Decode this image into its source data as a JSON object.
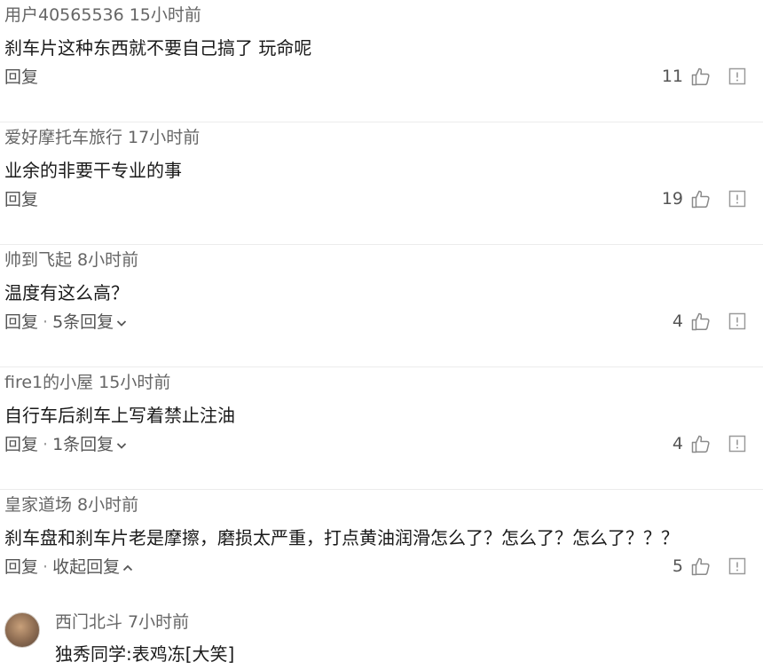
{
  "comments": [
    {
      "user": "用户40565536",
      "time": "15小时前",
      "text": "刹车片这种东西就不要自己搞了 玩命呢",
      "reply_label": "回复",
      "sub": "",
      "likes": "11"
    },
    {
      "user": "爱好摩托车旅行",
      "time": "17小时前",
      "text": "业余的非要干专业的事",
      "reply_label": "回复",
      "sub": "",
      "likes": "19"
    },
    {
      "user": "帅到飞起",
      "time": "8小时前",
      "text": "温度有这么高？",
      "reply_label": "回复",
      "sub": "5条回复",
      "likes": "4"
    },
    {
      "user": "fire1的小屋",
      "time": "15小时前",
      "text": "自行车后刹车上写着禁止注油",
      "reply_label": "回复",
      "sub": "1条回复",
      "likes": "4"
    },
    {
      "user": "皇家道场",
      "time": "8小时前",
      "text": "刹车盘和刹车片老是摩擦，磨损太严重，打点黄油润滑怎么了？怎么了？怎么了？？？",
      "reply_label": "回复",
      "sub": "收起回复",
      "likes": "5"
    }
  ],
  "reply": {
    "user": "西门北斗",
    "time": "7小时前",
    "text": "独秀同学:表鸡冻[大笑]"
  },
  "separator": "·"
}
